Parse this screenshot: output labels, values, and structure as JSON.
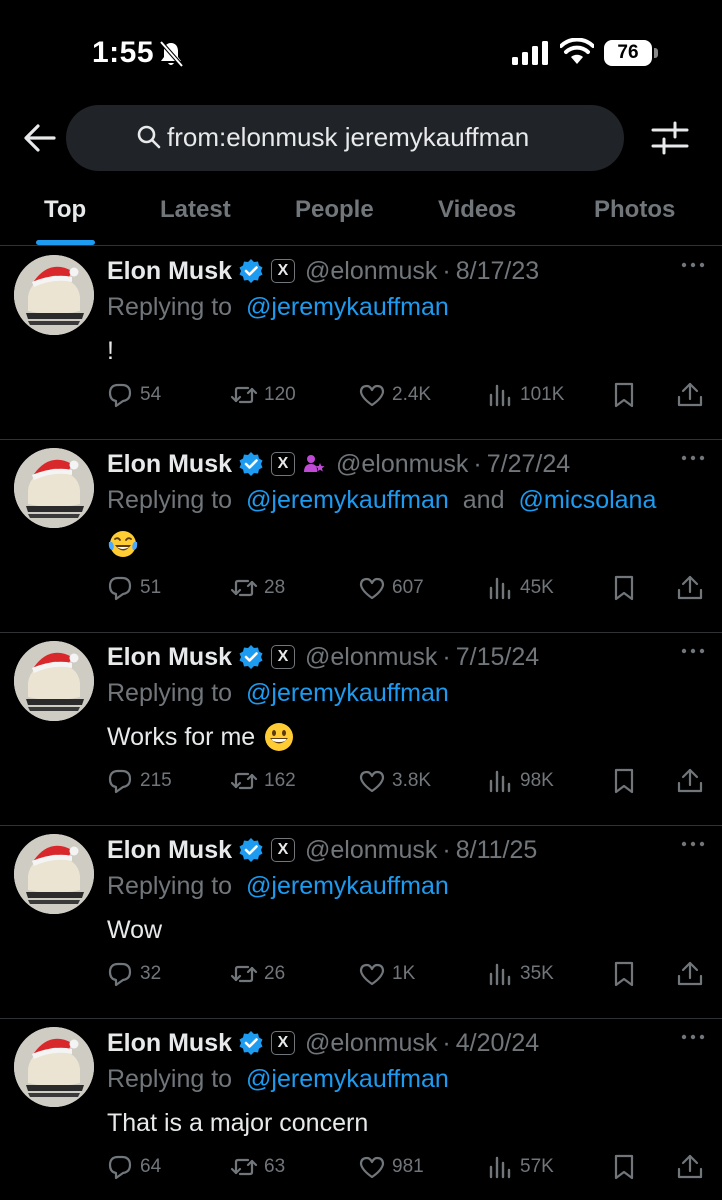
{
  "status_bar": {
    "time": "1:55",
    "battery": "76"
  },
  "search": {
    "query": "from:elonmusk jeremykauffman"
  },
  "tabs": [
    {
      "label": "Top",
      "active": true
    },
    {
      "label": "Latest",
      "active": false
    },
    {
      "label": "People",
      "active": false
    },
    {
      "label": "Videos",
      "active": false
    },
    {
      "label": "Photos",
      "active": false
    }
  ],
  "colors": {
    "accent": "#1d9bf0",
    "background": "#000000",
    "muted": "#71767b",
    "text": "#e7e9ea"
  },
  "tweets": [
    {
      "name": "Elon Musk",
      "x_badge": "X",
      "handle": "@elonmusk",
      "separator": "·",
      "date": "8/17/23",
      "replying_prefix": "Replying to",
      "mention1": "@jeremykauffman",
      "conjunction": "",
      "mention2": "",
      "text": "!",
      "emoji": "",
      "extra_badge": false,
      "stats": {
        "replies": "54",
        "retweets": "120",
        "likes": "2.4K",
        "views": "101K"
      }
    },
    {
      "name": "Elon Musk",
      "x_badge": "X",
      "handle": "@elonmusk",
      "separator": "·",
      "date": "7/27/24",
      "replying_prefix": "Replying to",
      "mention1": "@jeremykauffman",
      "conjunction": "and",
      "mention2": "@micsolana",
      "text": "",
      "emoji": "face-with-tears-of-joy",
      "extra_badge": true,
      "stats": {
        "replies": "51",
        "retweets": "28",
        "likes": "607",
        "views": "45K"
      }
    },
    {
      "name": "Elon Musk",
      "x_badge": "X",
      "handle": "@elonmusk",
      "separator": "·",
      "date": "7/15/24",
      "replying_prefix": "Replying to",
      "mention1": "@jeremykauffman",
      "conjunction": "",
      "mention2": "",
      "text": "Works for me",
      "emoji": "grinning-face",
      "extra_badge": false,
      "stats": {
        "replies": "215",
        "retweets": "162",
        "likes": "3.8K",
        "views": "98K"
      }
    },
    {
      "name": "Elon Musk",
      "x_badge": "X",
      "handle": "@elonmusk",
      "separator": "·",
      "date": "8/11/25",
      "replying_prefix": "Replying to",
      "mention1": "@jeremykauffman",
      "conjunction": "",
      "mention2": "",
      "text": "Wow",
      "emoji": "",
      "extra_badge": false,
      "stats": {
        "replies": "32",
        "retweets": "26",
        "likes": "1K",
        "views": "35K"
      }
    },
    {
      "name": "Elon Musk",
      "x_badge": "X",
      "handle": "@elonmusk",
      "separator": "·",
      "date": "4/20/24",
      "replying_prefix": "Replying to",
      "mention1": "@jeremykauffman",
      "conjunction": "",
      "mention2": "",
      "text": "That is a major concern",
      "emoji": "",
      "extra_badge": false,
      "stats": {
        "replies": "64",
        "retweets": "63",
        "likes": "981",
        "views": "57K"
      }
    }
  ]
}
